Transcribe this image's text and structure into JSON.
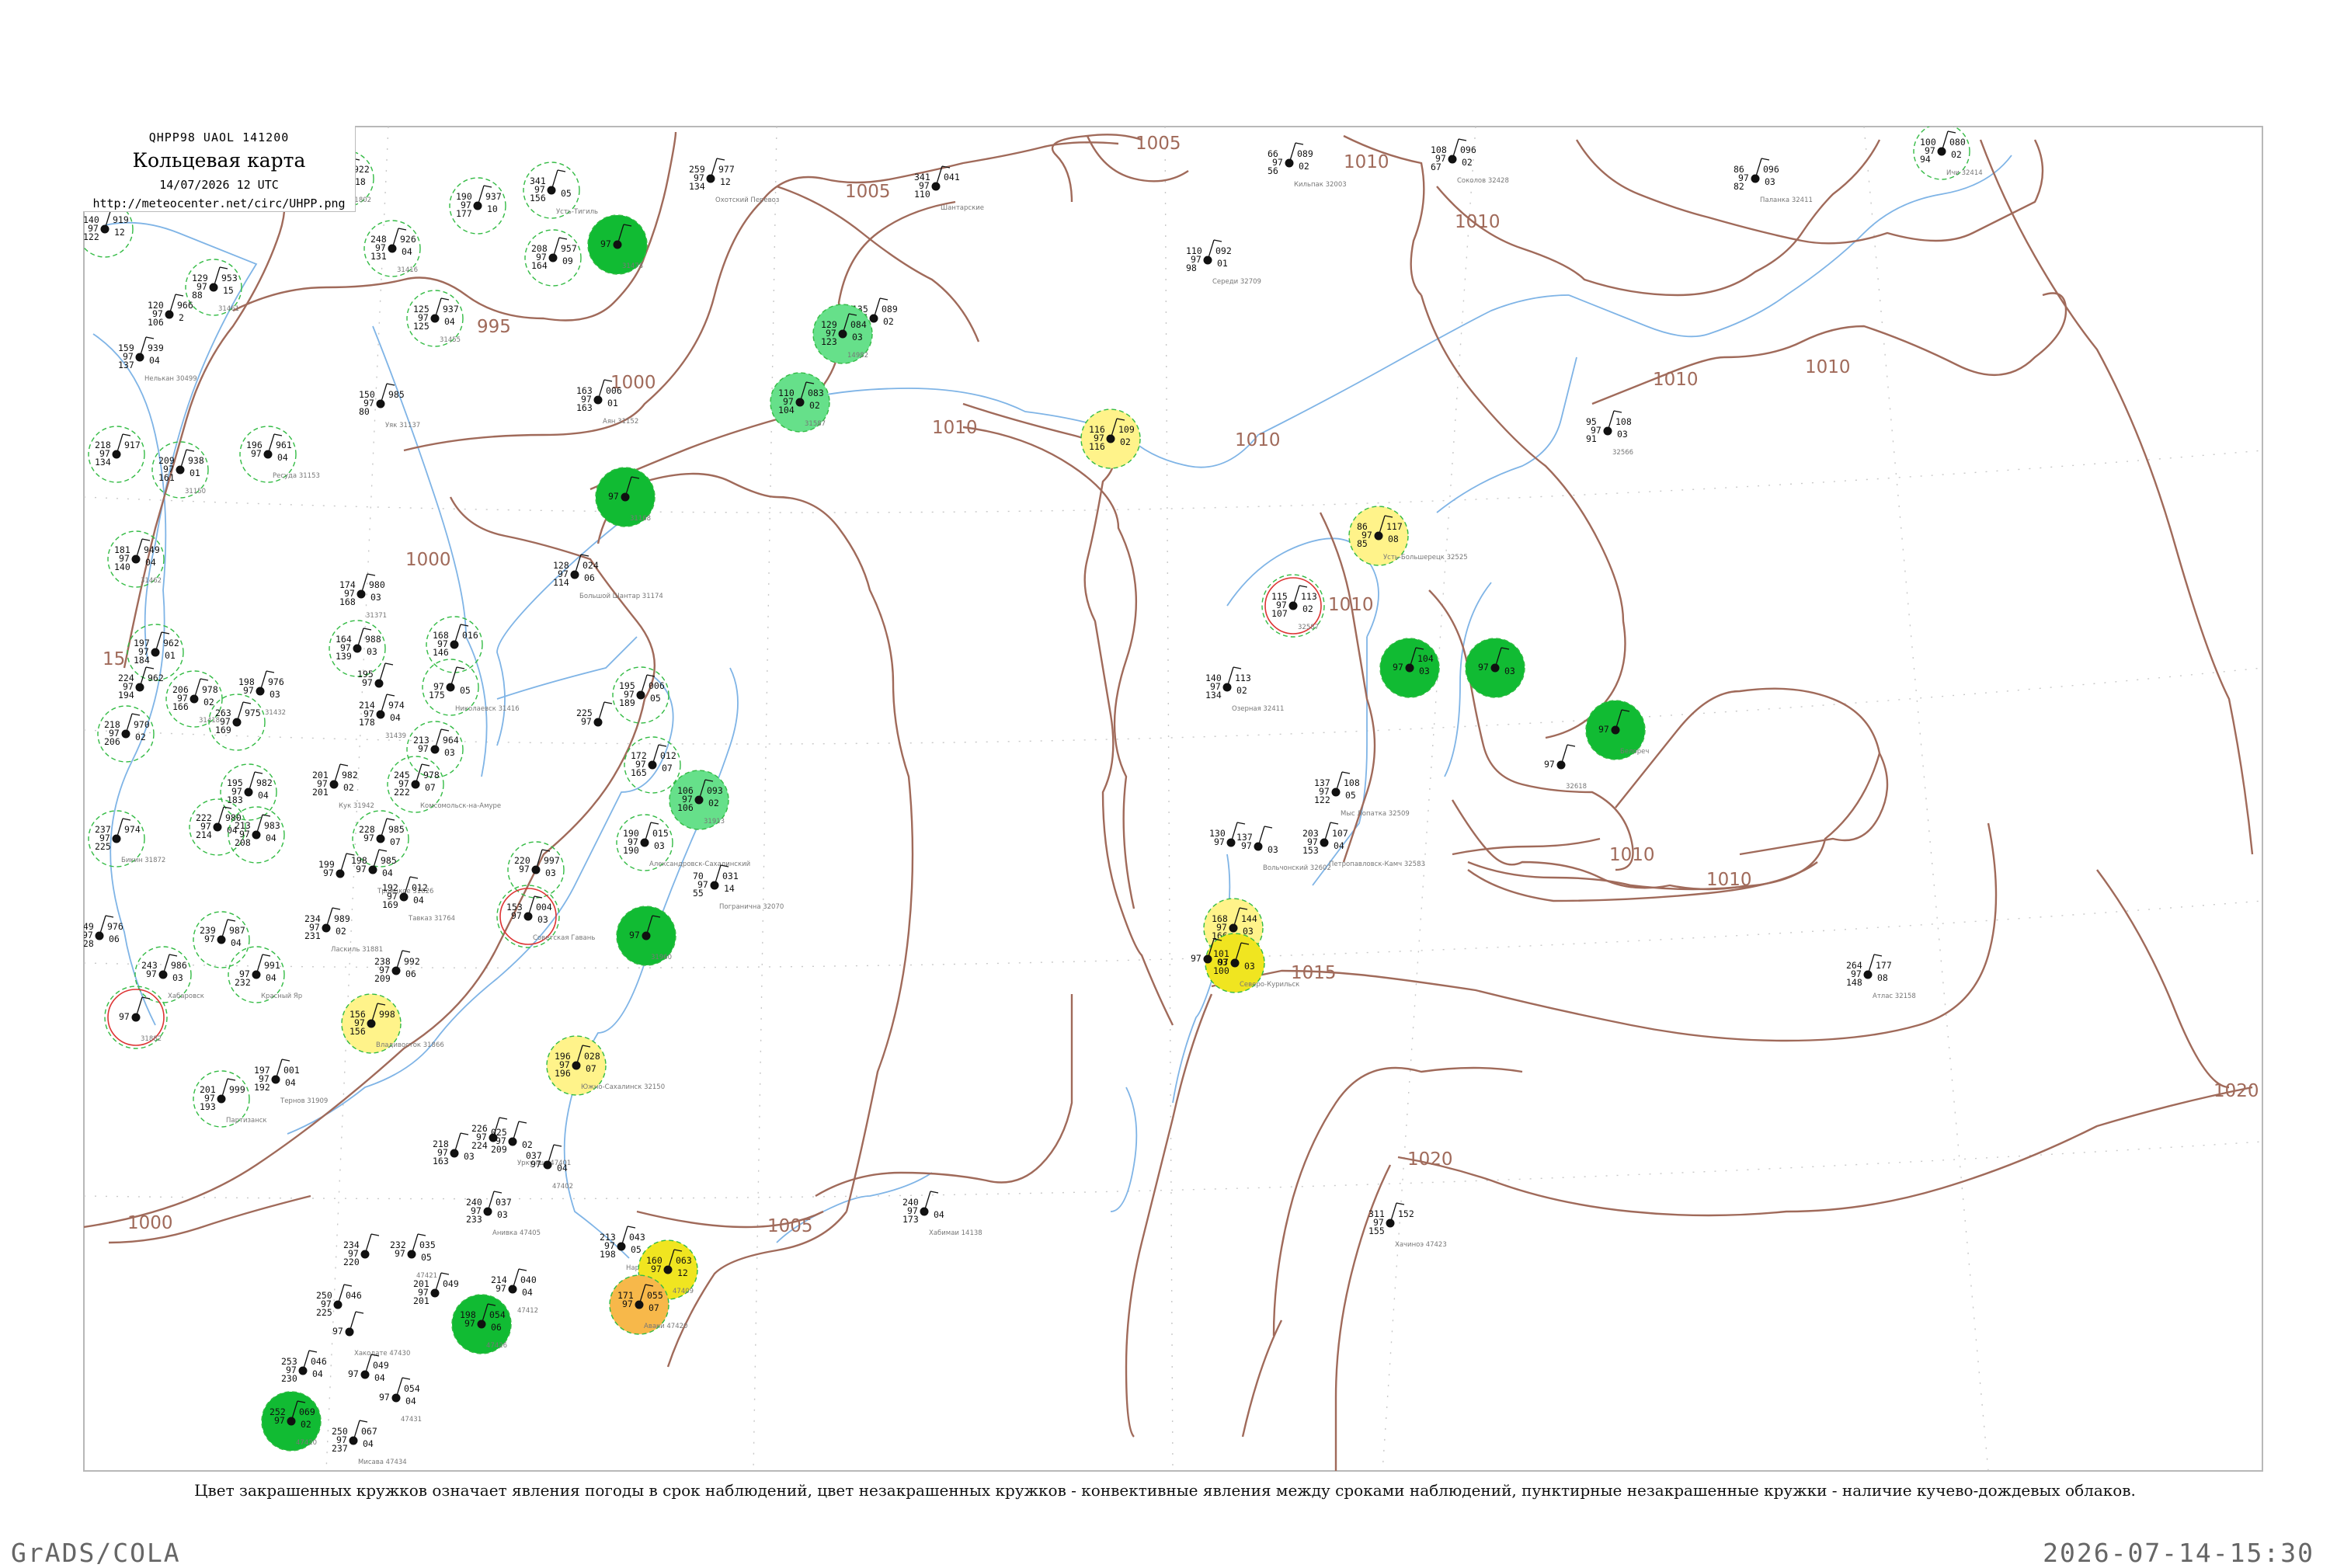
{
  "header": {
    "code": "QHPP98  UAOL  141200",
    "title": "Кольцевая карта",
    "datetime": "14/07/2026 12 UTC",
    "url": "http://meteocenter.net/circ/UHPP.png"
  },
  "caption": "Цвет закрашенных кружков означает явления погоды в срок наблюдений, цвет незакрашенных кружков - конвективные явления между сроками наблюдений, пунктирные незакрашенные кружки - наличие кучево-дождевых облаков.",
  "footer": {
    "left": "GrADS/COLA",
    "right": "2026-07-14-15:30"
  },
  "colors": {
    "isobar": "#a06a5a",
    "river": "#7fb4e6",
    "rain_green": "#11bb33",
    "showers_green": "#66e08a",
    "fog_yellow": "#fff38a",
    "thunder_yellow": "#f0e520",
    "haze_orange": "#f7b84a",
    "cb_dashed": "#33bb44",
    "thunder_between": "#dd3333"
  },
  "isobar_labels": [
    "1005",
    "1010",
    "1010",
    "1010",
    "995",
    "1000",
    "1005",
    "1010",
    "1010",
    "1010",
    "1010",
    "1000",
    "15",
    "1015",
    "1010",
    "1020",
    "1020",
    "1000",
    "1005"
  ],
  "stations": [
    {
      "t": "140",
      "p": "919",
      "td": "122",
      "n": "12",
      "name": ""
    },
    {
      "t": "217",
      "p": "922",
      "td": "202",
      "n": "18",
      "name": "31802"
    },
    {
      "t": "190",
      "p": "937",
      "td": "177",
      "n": "10",
      "name": ""
    },
    {
      "t": "341",
      "p": "",
      "td": "156",
      "n": "05",
      "name": "Усть-Тигиль"
    },
    {
      "t": "",
      "p": "",
      "td": "",
      "n": "",
      "name": "31478"
    },
    {
      "t": "129",
      "p": "953",
      "td": "88",
      "n": "15",
      "name": "31461"
    },
    {
      "t": "248",
      "p": "926",
      "td": "131",
      "n": "04",
      "name": "31416"
    },
    {
      "t": "208",
      "p": "957",
      "td": "164",
      "n": "09",
      "name": ""
    },
    {
      "t": "120",
      "p": "966",
      "td": "106",
      "n": "2",
      "name": ""
    },
    {
      "t": "159",
      "p": "939",
      "td": "137",
      "n": "04",
      "name": "Нелькан 30499"
    },
    {
      "t": "125",
      "p": "937",
      "td": "125",
      "n": "04",
      "name": "31455"
    },
    {
      "t": "259",
      "p": "977",
      "td": "134",
      "n": "12",
      "name": "Охотский Перевоз"
    },
    {
      "t": "341",
      "p": "041",
      "td": "110",
      "n": "",
      "name": "Шантарские"
    },
    {
      "t": "135",
      "p": "089",
      "td": "",
      "n": "02",
      "name": ""
    },
    {
      "t": "129",
      "p": "084",
      "td": "123",
      "n": "03",
      "name": "14982"
    },
    {
      "t": "110",
      "p": "083",
      "td": "104",
      "n": "02",
      "name": "31587"
    },
    {
      "t": "150",
      "p": "985",
      "td": "80",
      "n": "",
      "name": "Уяк 31137"
    },
    {
      "t": "163",
      "p": "006",
      "td": "163",
      "n": "01",
      "name": "Аян 31152"
    },
    {
      "t": "218",
      "p": "917",
      "td": "134",
      "n": "",
      "name": ""
    },
    {
      "t": "209",
      "p": "938",
      "td": "161",
      "n": "01",
      "name": "31150"
    },
    {
      "t": "196",
      "p": "961",
      "td": "",
      "n": "04",
      "name": "Ресуда 31153"
    },
    {
      "t": "",
      "p": "",
      "td": "",
      "n": "",
      "name": "31168"
    },
    {
      "t": "181",
      "p": "949",
      "td": "140",
      "n": "04",
      "name": "31462"
    },
    {
      "t": "128",
      "p": "024",
      "td": "114",
      "n": "06",
      "name": "Большой Шантар 31174"
    },
    {
      "t": "174",
      "p": "980",
      "td": "168",
      "n": "03",
      "name": "31371"
    },
    {
      "t": "164",
      "p": "988",
      "td": "139",
      "n": "03",
      "name": ""
    },
    {
      "t": "168",
      "p": "016",
      "td": "146",
      "n": "",
      "name": ""
    },
    {
      "t": "197",
      "p": "962",
      "td": "184",
      "n": "01",
      "name": ""
    },
    {
      "t": "224",
      "p": "962",
      "td": "194",
      "n": "",
      "name": ""
    },
    {
      "t": "206",
      "p": "978",
      "td": "166",
      "n": "02",
      "name": "31418"
    },
    {
      "t": "198",
      "p": "976",
      "td": "",
      "n": "03",
      "name": "31432"
    },
    {
      "t": "195",
      "p": "",
      "td": "",
      "n": "",
      "name": ""
    },
    {
      "t": "",
      "p": "",
      "td": "175",
      "n": "05",
      "name": "Николаевск 31416"
    },
    {
      "t": "195",
      "p": "006",
      "td": "189",
      "n": "05",
      "name": ""
    },
    {
      "t": "218",
      "p": "970",
      "td": "206",
      "n": "02",
      "name": ""
    },
    {
      "t": "214",
      "p": "974",
      "td": "178",
      "n": "04",
      "name": "31439"
    },
    {
      "t": "263",
      "p": "975",
      "td": "169",
      "n": "",
      "name": ""
    },
    {
      "t": "213",
      "p": "964",
      "td": "",
      "n": "03",
      "name": ""
    },
    {
      "t": "245",
      "p": "978",
      "td": "222",
      "n": "07",
      "name": "Комсомольск-на-Амуре"
    },
    {
      "t": "225",
      "p": "",
      "td": "",
      "n": "",
      "name": ""
    },
    {
      "t": "172",
      "p": "012",
      "td": "165",
      "n": "07",
      "name": ""
    },
    {
      "t": "106",
      "p": "093",
      "td": "106",
      "n": "02",
      "name": "31913"
    },
    {
      "t": "195",
      "p": "982",
      "td": "183",
      "n": "04",
      "name": ""
    },
    {
      "t": "222",
      "p": "980",
      "td": "214",
      "n": "04",
      "name": ""
    },
    {
      "t": "213",
      "p": "983",
      "td": "208",
      "n": "04",
      "name": ""
    },
    {
      "t": "201",
      "p": "982",
      "td": "201",
      "n": "02",
      "name": "Кук 31942"
    },
    {
      "t": "237",
      "p": "974",
      "td": "225",
      "n": "",
      "name": "Бикин 31872"
    },
    {
      "t": "228",
      "p": "985",
      "td": "",
      "n": "07",
      "name": ""
    },
    {
      "t": "198",
      "p": "985",
      "td": "",
      "n": "04",
      "name": "Троицкое 31826"
    },
    {
      "t": "190",
      "p": "015",
      "td": "190",
      "n": "03",
      "name": "Александровск-Сахалинский"
    },
    {
      "t": "70",
      "p": "031",
      "td": "55",
      "n": "14",
      "name": "Погранична 32070"
    },
    {
      "t": "220",
      "p": "997",
      "td": "",
      "n": "03",
      "name": ""
    },
    {
      "t": "199",
      "p": "",
      "td": "",
      "n": "",
      "name": ""
    },
    {
      "t": "192",
      "p": "012",
      "td": "169",
      "n": "04",
      "name": "Тавказ 31764"
    },
    {
      "t": "153",
      "p": "004",
      "td": "",
      "n": "03",
      "name": "Советская Гавань"
    },
    {
      "t": "249",
      "p": "976",
      "td": "228",
      "n": "06",
      "name": ""
    },
    {
      "t": "234",
      "p": "989",
      "td": "231",
      "n": "02",
      "name": "Ласкиль 31881"
    },
    {
      "t": "239",
      "p": "987",
      "td": "",
      "n": "04",
      "name": ""
    },
    {
      "t": "243",
      "p": "986",
      "td": "",
      "n": "03",
      "name": "Хабаровск"
    },
    {
      "t": "",
      "p": "991",
      "td": "232",
      "n": "04",
      "name": "Красный Яр"
    },
    {
      "t": "238",
      "p": "992",
      "td": "209",
      "n": "06",
      "name": ""
    },
    {
      "t": "",
      "p": "",
      "td": "",
      "n": "",
      "name": "31960"
    },
    {
      "t": "",
      "p": "",
      "td": "",
      "n": "",
      "name": "31882"
    },
    {
      "t": "156",
      "p": "998",
      "td": "156",
      "n": "",
      "name": "Владивосток 31866"
    },
    {
      "t": "196",
      "p": "028",
      "td": "196",
      "n": "07",
      "name": "Южно-Сахалинск 32150"
    },
    {
      "t": "197",
      "p": "001",
      "td": "192",
      "n": "04",
      "name": "Тернов 31909"
    },
    {
      "t": "201",
      "p": "999",
      "td": "193",
      "n": "",
      "name": "Партизанск"
    },
    {
      "t": "218",
      "p": "",
      "td": "163",
      "n": "03",
      "name": ""
    },
    {
      "t": "226",
      "p": "",
      "td": "224",
      "n": "",
      "name": ""
    },
    {
      "t": "025",
      "p": "",
      "td": "209",
      "n": "02",
      "name": "Уркунши 47401"
    },
    {
      "t": "037",
      "p": "",
      "td": "",
      "n": "04",
      "name": "47402"
    },
    {
      "t": "240",
      "p": "037",
      "td": "233",
      "n": "03",
      "name": "Анивка 47405"
    },
    {
      "t": "213",
      "p": "043",
      "td": "198",
      "n": "05",
      "name": "Нарби 47407"
    },
    {
      "t": "160",
      "p": "063",
      "td": "",
      "n": "12",
      "name": "47409"
    },
    {
      "t": "171",
      "p": "055",
      "td": "",
      "n": "07",
      "name": "Аваки 47420"
    },
    {
      "t": "234",
      "p": "",
      "td": "220",
      "n": "",
      "name": ""
    },
    {
      "t": "232",
      "p": "035",
      "td": "",
      "n": "05",
      "name": "47421"
    },
    {
      "t": "201",
      "p": "049",
      "td": "201",
      "n": "",
      "name": ""
    },
    {
      "t": "214",
      "p": "040",
      "td": "",
      "n": "04",
      "name": "47412"
    },
    {
      "t": "198",
      "p": "054",
      "td": "",
      "n": "06",
      "name": "47426"
    },
    {
      "t": "250",
      "p": "046",
      "td": "225",
      "n": "",
      "name": ""
    },
    {
      "t": "",
      "p": "",
      "td": "",
      "n": "",
      "name": "Хакодате 47430"
    },
    {
      "t": "253",
      "p": "046",
      "td": "230",
      "n": "04",
      "name": ""
    },
    {
      "t": "",
      "p": "049",
      "td": "",
      "n": "04",
      "name": ""
    },
    {
      "t": "",
      "p": "054",
      "td": "",
      "n": "04",
      "name": "47431"
    },
    {
      "t": "252",
      "p": "069",
      "td": "",
      "n": "02",
      "name": "47420"
    },
    {
      "t": "250",
      "p": "067",
      "td": "237",
      "n": "04",
      "name": "Мисава 47434"
    },
    {
      "t": "240",
      "p": "",
      "td": "173",
      "n": "04",
      "name": "Хабимаи 14138"
    },
    {
      "t": "311",
      "p": "152",
      "td": "155",
      "n": "",
      "name": "Хачиноэ 47423"
    },
    {
      "t": "66",
      "p": "089",
      "td": "56",
      "n": "02",
      "name": "Кильпак 32003"
    },
    {
      "t": "108",
      "p": "096",
      "td": "67",
      "n": "02",
      "name": "Соколов 32428"
    },
    {
      "t": "86",
      "p": "096",
      "td": "82",
      "n": "03",
      "name": "Паланка 32411"
    },
    {
      "t": "100",
      "p": "080",
      "td": "94",
      "n": "02",
      "name": "Ичи 32414"
    },
    {
      "t": "110",
      "p": "092",
      "td": "98",
      "n": "01",
      "name": "Середи 32709"
    },
    {
      "t": "116",
      "p": "109",
      "td": "116",
      "n": "02",
      "name": ""
    },
    {
      "t": "95",
      "p": "108",
      "td": "91",
      "n": "03",
      "name": "32566"
    },
    {
      "t": "86",
      "p": "117",
      "td": "85",
      "n": "08",
      "name": "Усть-Большерецк 32525"
    },
    {
      "t": "115",
      "p": "113",
      "td": "107",
      "n": "02",
      "name": "32587"
    },
    {
      "t": "140",
      "p": "113",
      "td": "134",
      "n": "02",
      "name": "Озерная 32411"
    },
    {
      "t": "",
      "p": "104",
      "td": "",
      "n": "03",
      "name": ""
    },
    {
      "t": "",
      "p": "",
      "td": "",
      "n": "03",
      "name": ""
    },
    {
      "t": "",
      "p": "",
      "td": "",
      "n": "",
      "name": "Белореч"
    },
    {
      "t": "",
      "p": "",
      "td": "",
      "n": "",
      "name": "32618"
    },
    {
      "t": "137",
      "p": "108",
      "td": "122",
      "n": "05",
      "name": "Мыс Лопатка 32509"
    },
    {
      "t": "130",
      "p": "",
      "td": "",
      "n": "",
      "name": ""
    },
    {
      "t": "137",
      "p": "",
      "td": "",
      "n": "03",
      "name": "Вольчонский 32602"
    },
    {
      "t": "203",
      "p": "107",
      "td": "153",
      "n": "04",
      "name": "Петропавловск-Камч 32583"
    },
    {
      "t": "168",
      "p": "144",
      "td": "166",
      "n": "03",
      "name": ""
    },
    {
      "t": "101",
      "p": "",
      "td": "100",
      "n": "03",
      "name": "Северо-Курильск"
    },
    {
      "t": "",
      "p": "",
      "td": "",
      "n": "03",
      "name": ""
    },
    {
      "t": "264",
      "p": "177",
      "td": "148",
      "n": "08",
      "name": "Атлас 32158"
    }
  ]
}
